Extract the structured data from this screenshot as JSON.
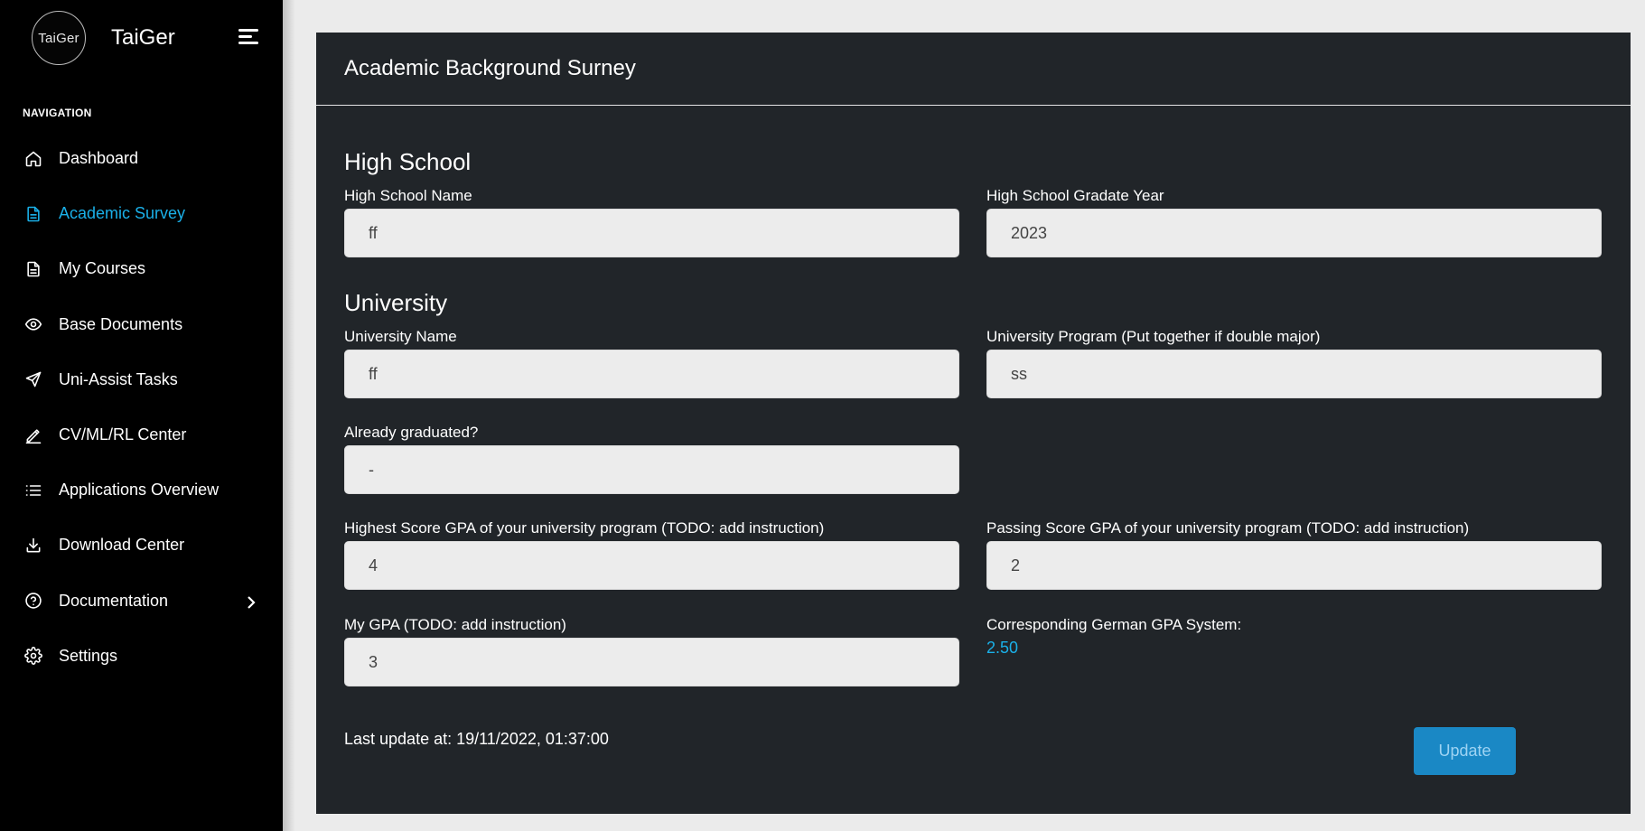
{
  "brand": {
    "logo_text": "TaiGer",
    "name": "TaiGer"
  },
  "sidebar": {
    "heading": "NAVIGATION",
    "items": [
      {
        "label": "Dashboard",
        "icon": "home-icon",
        "active": false
      },
      {
        "label": "Academic Survey",
        "icon": "document-icon",
        "active": true
      },
      {
        "label": "My Courses",
        "icon": "document-icon",
        "active": false
      },
      {
        "label": "Base Documents",
        "icon": "eye-icon",
        "active": false
      },
      {
        "label": "Uni-Assist Tasks",
        "icon": "send-icon",
        "active": false
      },
      {
        "label": "CV/ML/RL Center",
        "icon": "edit-icon",
        "active": false
      },
      {
        "label": "Applications Overview",
        "icon": "list-icon",
        "active": false
      },
      {
        "label": "Download Center",
        "icon": "download-icon",
        "active": false
      },
      {
        "label": "Documentation",
        "icon": "help-circle-icon",
        "active": false,
        "has_submenu": true
      },
      {
        "label": "Settings",
        "icon": "gear-icon",
        "active": false
      }
    ]
  },
  "colors": {
    "sidebar_bg": "#000000",
    "active_accent": "#1ab0e8",
    "card_bg": "#212529",
    "button_bg": "#1a88c5",
    "page_bg": "#ebebeb"
  },
  "survey": {
    "title": "Academic Background Surney",
    "high_school": {
      "section_title": "High School",
      "name_label": "High School Name",
      "name_value": "ff",
      "year_label": "High School Gradate Year",
      "year_value": "2023"
    },
    "university": {
      "section_title": "University",
      "name_label": "University Name",
      "name_value": "ff",
      "program_label": "University Program (Put together if double major)",
      "program_value": "ss",
      "graduated_label": "Already graduated?",
      "graduated_value": "-",
      "highest_gpa_label": "Highest Score GPA of your university program (TODO: add instruction)",
      "highest_gpa_value": "4",
      "passing_gpa_label": "Passing Score GPA of your university program (TODO: add instruction)",
      "passing_gpa_value": "2",
      "my_gpa_label": "My GPA (TODO: add instruction)",
      "my_gpa_value": "3",
      "german_gpa_label": "Corresponding German GPA System:",
      "german_gpa_value": "2.50"
    },
    "last_update": "Last update at: 19/11/2022, 01:37:00",
    "update_button": "Update"
  }
}
